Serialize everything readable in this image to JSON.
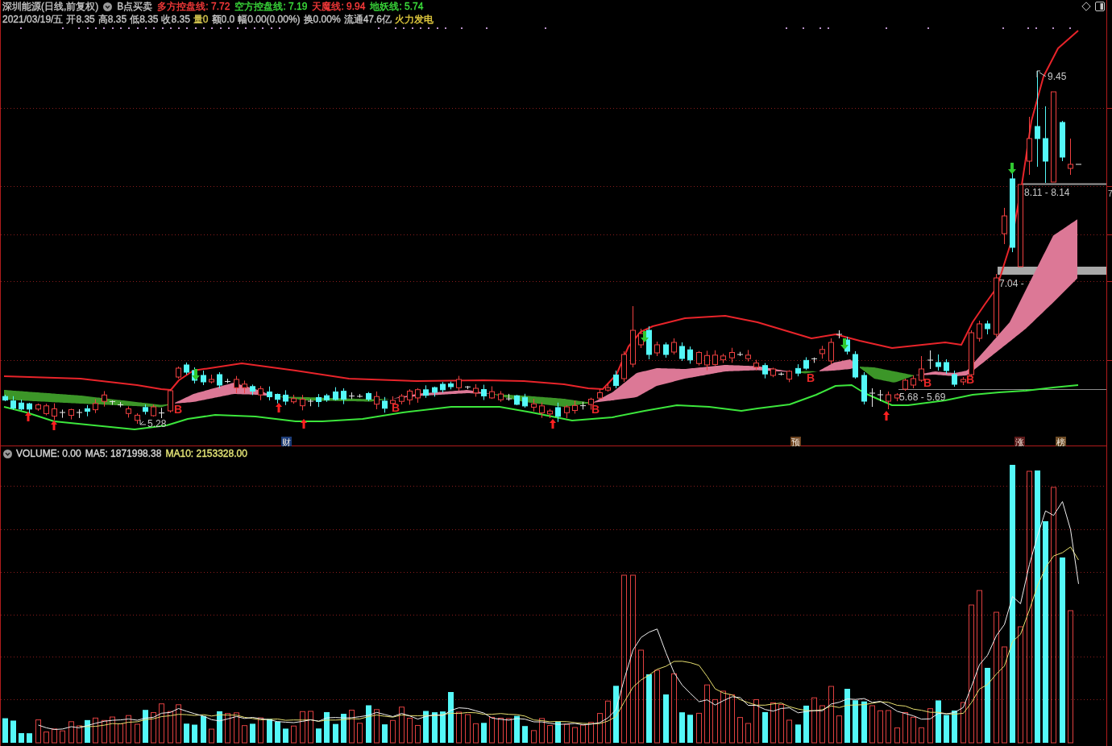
{
  "header": {
    "title": "深圳能源(日线,前复权)",
    "formula": "B点买卖",
    "indicators": [
      {
        "text": "多方控盘线: 7.72",
        "color": "#ff3c3c"
      },
      {
        "text": "空方控盘线: 7.19",
        "color": "#3ce03c"
      },
      {
        "text": "天魔线: 9.94",
        "color": "#ff3c3c"
      },
      {
        "text": "地妖线: 5.74",
        "color": "#3ce03c"
      }
    ]
  },
  "quote": [
    {
      "text": "2021/03/19/五",
      "color": "#c8c8c8"
    },
    {
      "text": "开8.35",
      "color": "#c8c8c8"
    },
    {
      "text": "高8.35",
      "color": "#c8c8c8"
    },
    {
      "text": "低8.35",
      "color": "#c8c8c8"
    },
    {
      "text": "收8.35",
      "color": "#c8c8c8"
    },
    {
      "text": "量0",
      "color": "#d8c850"
    },
    {
      "text": "额0.0",
      "color": "#c8c8c8"
    },
    {
      "text": "幅0.00(0.00%)",
      "color": "#c8c8c8"
    },
    {
      "text": "换0.00%",
      "color": "#c8c8c8"
    },
    {
      "text": "流通47.6亿",
      "color": "#c8c8c8"
    },
    {
      "text": "火力发电",
      "color": "#e8d040"
    }
  ],
  "price_chart": {
    "labels": [
      "9.45",
      "8.11 - 8.14",
      "7.04 -",
      "5.68 - 5.69",
      "5.28"
    ],
    "signals": [
      "B",
      "B",
      "B",
      "B",
      "B",
      "B"
    ],
    "events": [
      {
        "text": "财",
        "color": "#1c3c78"
      },
      {
        "text": "预",
        "color": "#6e4420"
      },
      {
        "text": "涨",
        "color": "#5c1a1a"
      },
      {
        "text": "榜",
        "color": "#6e4c26"
      }
    ],
    "axis_label": "7"
  },
  "volume": {
    "legend": [
      {
        "text": "VOLUME: 0.00",
        "color": "#d8d8d8"
      },
      {
        "text": "MA5: 1871998.38",
        "color": "#d8d8d8"
      },
      {
        "text": "MA10: 2153328.00",
        "color": "#e8e878"
      }
    ]
  }
}
